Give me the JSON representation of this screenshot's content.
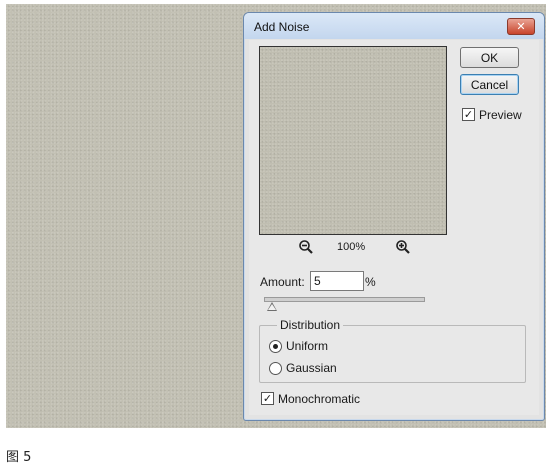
{
  "dialog": {
    "title": "Add Noise",
    "close_glyph": "✕",
    "ok_label": "OK",
    "cancel_label": "Cancel",
    "preview_label": "Preview",
    "preview_checked": true,
    "zoom_level": "100%",
    "zoom_out_icon": "zoom-out-magnifier",
    "zoom_in_icon": "zoom-in-magnifier",
    "amount_label": "Amount:",
    "amount_value": "5",
    "amount_unit": "%",
    "amount_slider_fraction": 0.05,
    "distribution": {
      "legend": "Distribution",
      "options": [
        "Uniform",
        "Gaussian"
      ],
      "selected": "Uniform"
    },
    "monochromatic_label": "Monochromatic",
    "monochromatic_checked": true
  },
  "caption": "图 5",
  "colors": {
    "canvas": "#c2c0b3",
    "dialog_bg": "#e8e8e8",
    "titlebar": "#c3d6ee",
    "close_button": "#c8442b"
  }
}
